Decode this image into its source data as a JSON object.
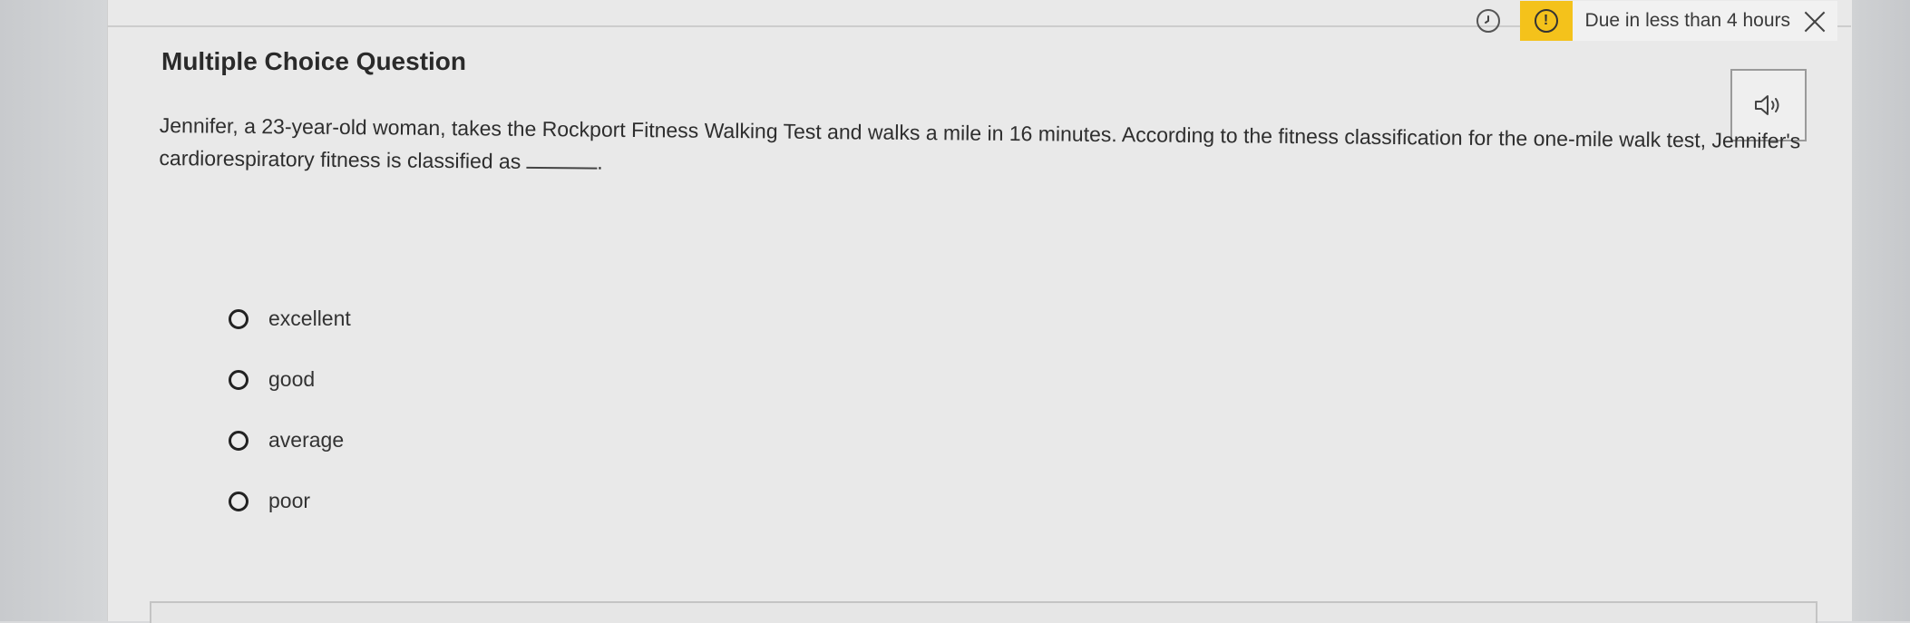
{
  "header": {
    "due_text": "Due in less than 4 hours",
    "alert_symbol": "!",
    "icons": {
      "clock": "clock-icon",
      "alert": "alert-icon",
      "close": "close-icon"
    },
    "alert_color": "#f4c21b"
  },
  "question": {
    "type_label": "Multiple Choice Question",
    "text": "Jennifer, a 23-year-old woman, takes the Rockport Fitness Walking Test and walks a mile in 16 minutes. According to the fitness classification for the one-mile walk test, Jennifer's cardiorespiratory fitness is classified as",
    "text_end": ".",
    "audio_icon": "speaker-icon"
  },
  "options": [
    {
      "label": "excellent"
    },
    {
      "label": "good"
    },
    {
      "label": "average"
    },
    {
      "label": "poor"
    }
  ]
}
